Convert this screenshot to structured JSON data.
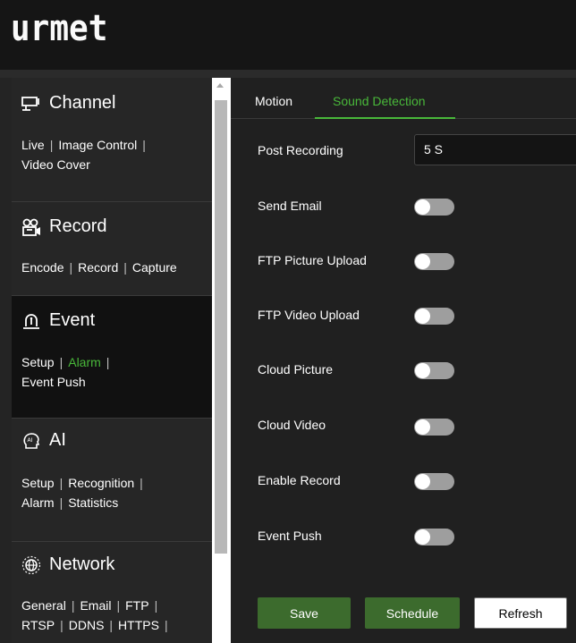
{
  "header": {
    "logo_text": "urmet"
  },
  "sidebar": {
    "channel": {
      "title": "Channel",
      "icon": "monitor-icon",
      "links": [
        "Live",
        "Image Control",
        "Video Cover"
      ]
    },
    "record": {
      "title": "Record",
      "icon": "record-icon",
      "links": [
        "Encode",
        "Record",
        "Capture"
      ]
    },
    "event": {
      "title": "Event",
      "icon": "alarm-light-icon",
      "links": [
        "Setup",
        "Alarm",
        "Event Push"
      ],
      "active_link": "Alarm"
    },
    "ai": {
      "title": "AI",
      "icon": "ai-head-icon",
      "links": [
        "Setup",
        "Recognition",
        "Alarm",
        "Statistics"
      ]
    },
    "network": {
      "title": "Network",
      "icon": "network-globe-icon",
      "links": [
        "General",
        "Email",
        "FTP",
        "RTSP",
        "DDNS",
        "HTTPS"
      ]
    }
  },
  "tabs": {
    "motion": "Motion",
    "sound_detection": "Sound Detection",
    "active": "Sound Detection"
  },
  "form": {
    "post_recording_label": "Post Recording",
    "post_recording_value": "5 S",
    "toggles": [
      {
        "label": "Send Email",
        "on": false
      },
      {
        "label": "FTP Picture Upload",
        "on": false
      },
      {
        "label": "FTP Video Upload",
        "on": false
      },
      {
        "label": "Cloud Picture",
        "on": false
      },
      {
        "label": "Cloud Video",
        "on": false
      },
      {
        "label": "Enable Record",
        "on": false
      },
      {
        "label": "Event Push",
        "on": false
      }
    ]
  },
  "buttons": {
    "save": "Save",
    "schedule": "Schedule",
    "refresh": "Refresh"
  },
  "colors": {
    "accent_green": "#49b83a",
    "button_green": "#3c6b2d",
    "toggle_off": "#9e9e9e"
  }
}
